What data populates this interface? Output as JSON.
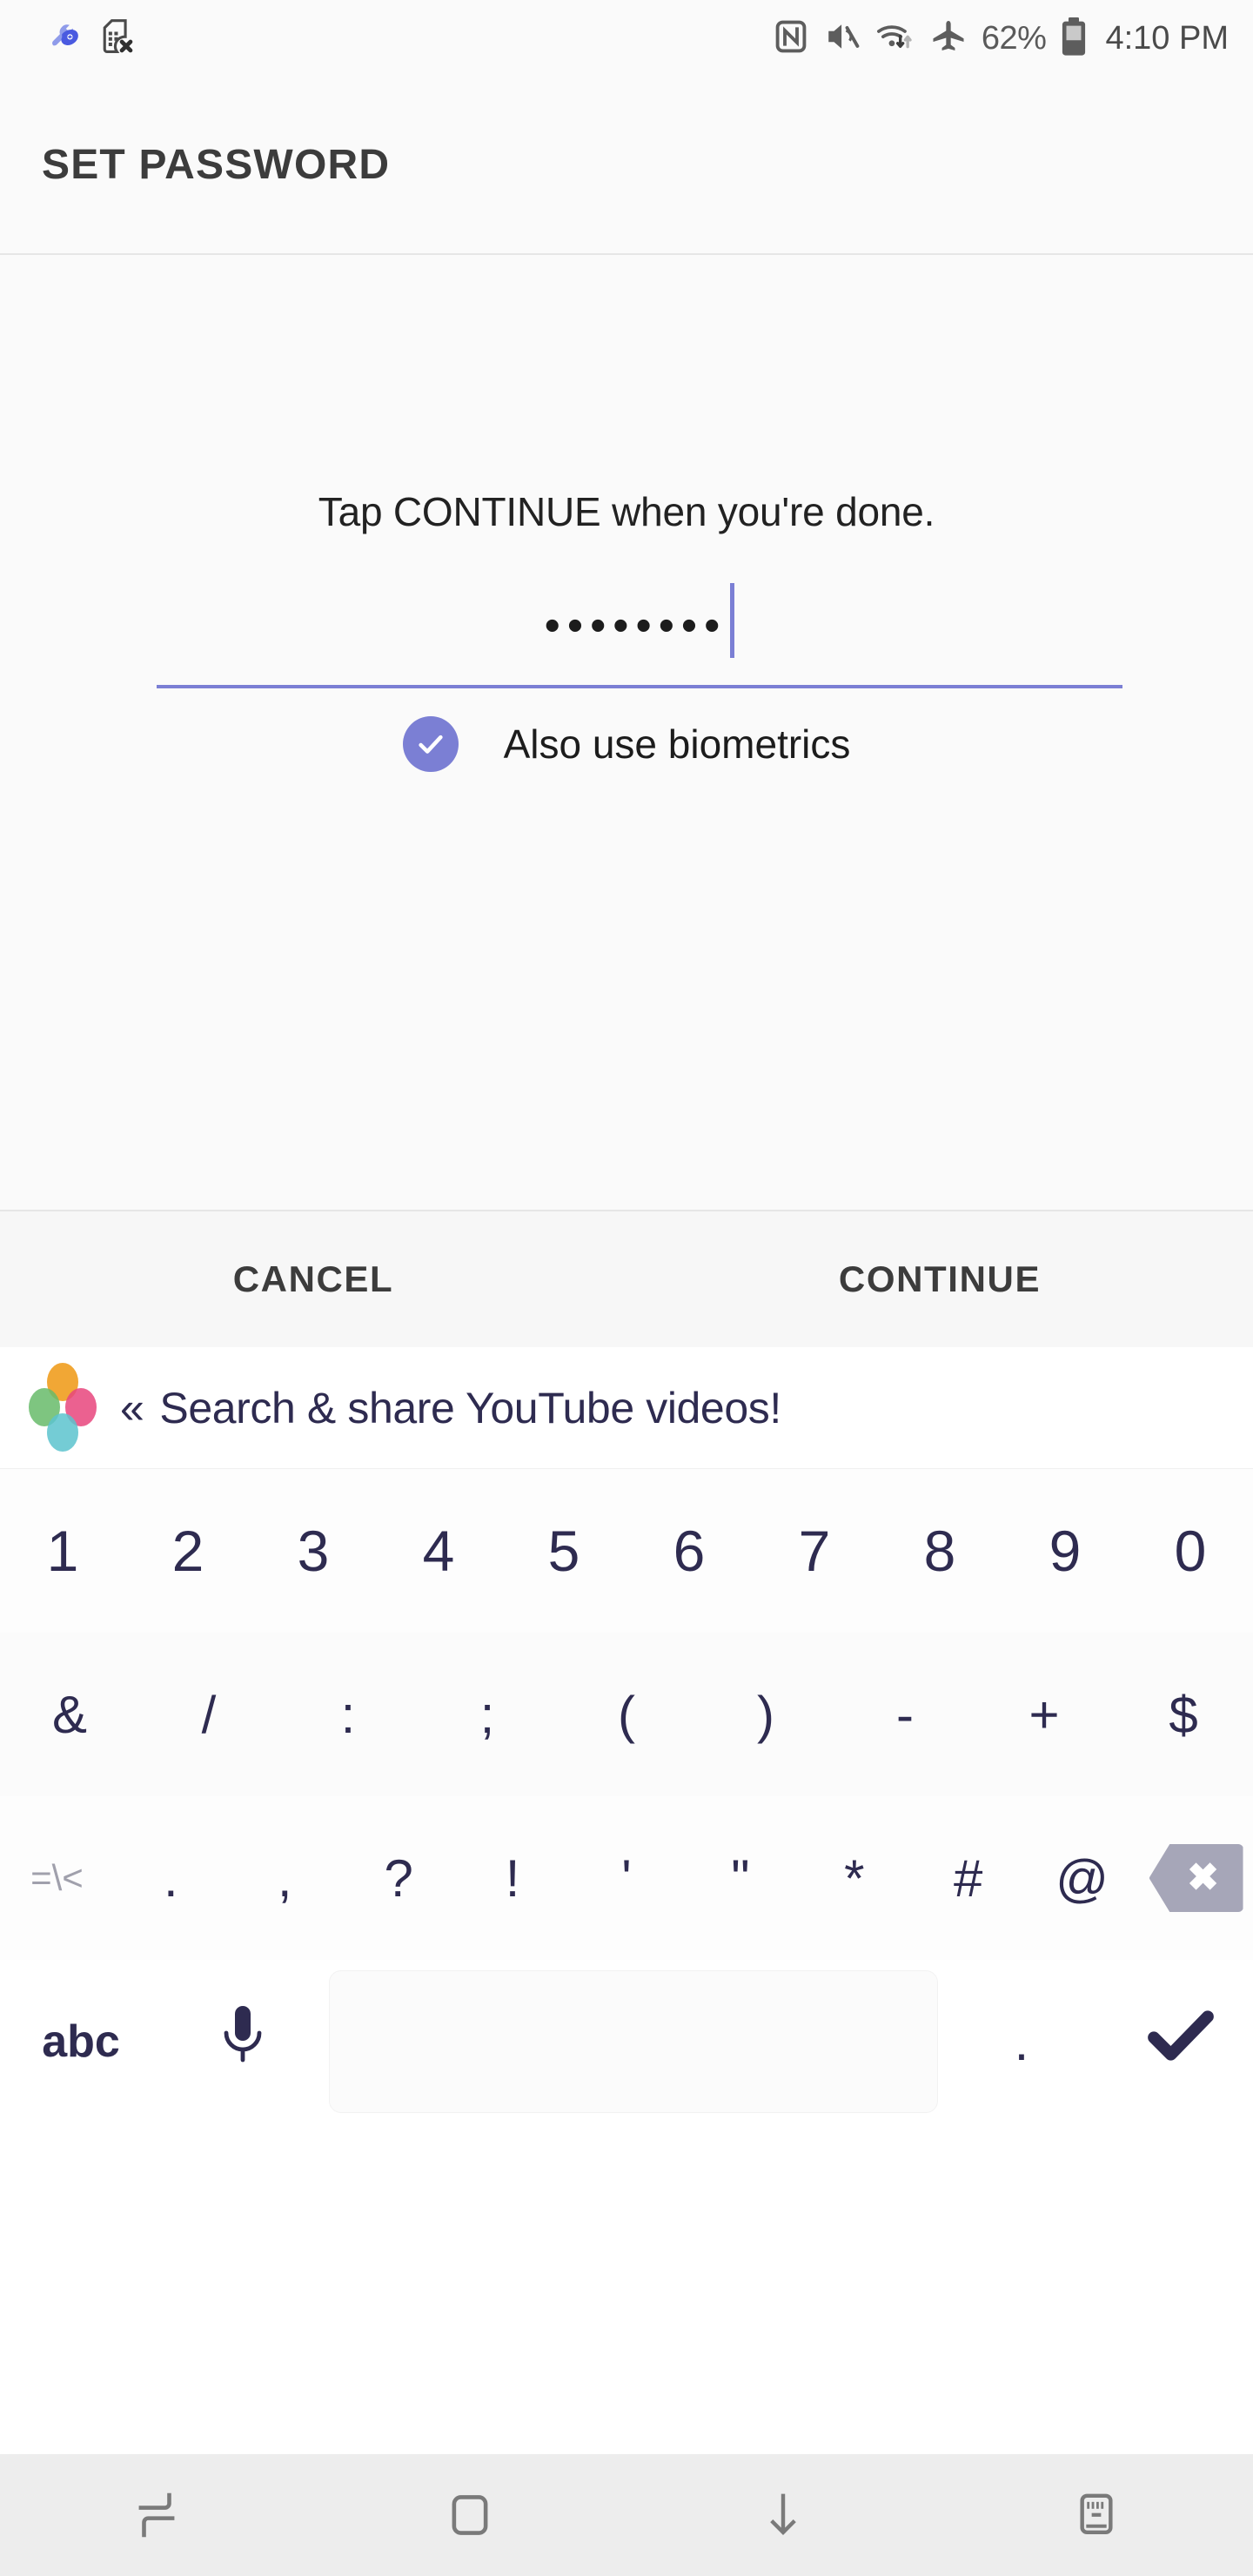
{
  "status_bar": {
    "left_icons": [
      {
        "name": "device-care-icon"
      },
      {
        "name": "no-sim-card-icon"
      }
    ],
    "right_icons": [
      {
        "name": "nfc-icon"
      },
      {
        "name": "mute-icon"
      },
      {
        "name": "wifi-data-transfer-icon"
      },
      {
        "name": "airplane-mode-icon"
      }
    ],
    "battery_percent": "62%",
    "battery_icon": "battery-icon",
    "clock": "4:10 PM"
  },
  "app_bar": {
    "title": "SET PASSWORD"
  },
  "content": {
    "prompt": "Tap CONTINUE when you're done.",
    "password_value": "••••••••",
    "biometrics_label": "Also use biometrics",
    "biometrics_checked": true,
    "check_icon": "check-icon"
  },
  "actions": {
    "cancel_label": "CANCEL",
    "continue_label": "CONTINUE"
  },
  "keyboard": {
    "suggestion_bar": {
      "logo_icon": "flower-logo-icon",
      "collapse_icon": "chevron-double-left-icon",
      "text": "Search & share YouTube videos!"
    },
    "row1": [
      "1",
      "2",
      "3",
      "4",
      "5",
      "6",
      "7",
      "8",
      "9",
      "0"
    ],
    "row2": [
      "&",
      "/",
      ":",
      ";",
      "(",
      ")",
      "-",
      "+",
      "$"
    ],
    "row3_mode": "=\\<",
    "row3": [
      ".",
      ",",
      "?",
      "!",
      "'",
      "\"",
      "*",
      "#",
      "@"
    ],
    "row3_backspace": "backspace-icon",
    "row4": {
      "abc_label": "abc",
      "mic_icon": "microphone-icon",
      "space_label": "",
      "dot_label": ".",
      "enter_icon": "check-enter-icon"
    }
  },
  "nav_bar": {
    "items": [
      {
        "name": "recents-icon"
      },
      {
        "name": "home-icon"
      },
      {
        "name": "hide-keyboard-icon"
      },
      {
        "name": "keyboard-switch-icon"
      }
    ]
  },
  "colors": {
    "accent": "#7b7fd4",
    "keyboard_text": "#2e2b50",
    "app_background": "#fafafa"
  }
}
